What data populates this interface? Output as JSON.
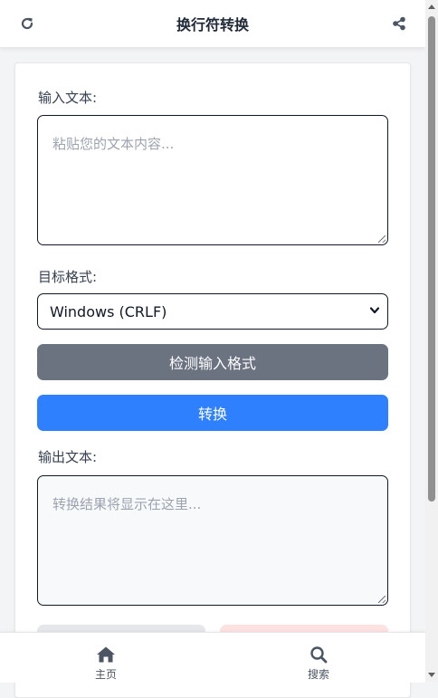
{
  "header": {
    "title": "换行符转换",
    "left_icon": "refresh-icon",
    "right_icon": "share-icon"
  },
  "input": {
    "label": "输入文本:",
    "placeholder": "粘贴您的文本内容..."
  },
  "target_format": {
    "label": "目标格式:",
    "selected": "Windows (CRLF)"
  },
  "buttons": {
    "detect": "检测输入格式",
    "convert": "转换"
  },
  "output": {
    "label": "输出文本:",
    "placeholder": "转换结果将显示在这里..."
  },
  "bottom_nav": {
    "items": [
      {
        "label": "主页",
        "icon": "home-icon"
      },
      {
        "label": "搜索",
        "icon": "search-icon"
      }
    ]
  },
  "colors": {
    "primary": "#2f80ff",
    "secondary": "#6b7280",
    "icon": "#4b5563"
  }
}
